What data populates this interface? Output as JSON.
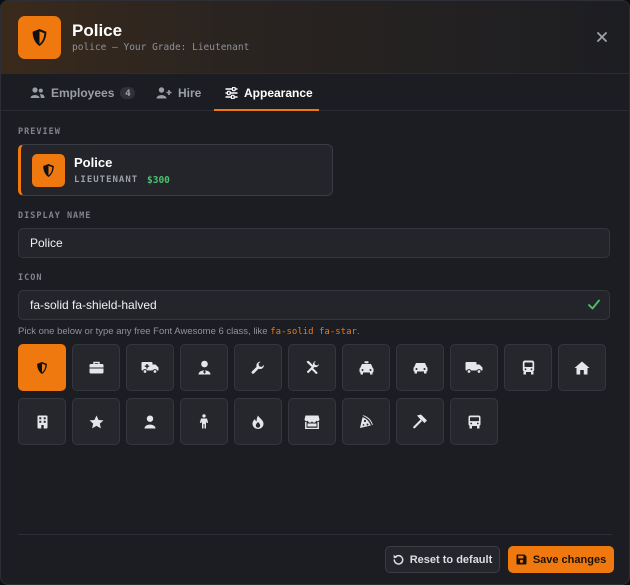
{
  "header": {
    "title": "Police",
    "subtitle": "police — Your Grade: Lieutenant",
    "icon": "shield-halved-icon"
  },
  "tabs": [
    {
      "label": "Employees",
      "count": "4",
      "icon": "users-icon"
    },
    {
      "label": "Hire",
      "icon": "user-plus-icon"
    },
    {
      "label": "Appearance",
      "icon": "sliders-icon",
      "active": true
    }
  ],
  "preview": {
    "section_label": "PREVIEW",
    "name": "Police",
    "grade": "LIEUTENANT",
    "salary": "$300"
  },
  "display_name": {
    "label": "DISPLAY NAME",
    "value": "Police"
  },
  "icon_field": {
    "label": "ICON",
    "value": "fa-solid fa-shield-halved"
  },
  "hint": {
    "text": "Pick one below or type any free Font Awesome 6 class, like ",
    "example": "fa-solid fa-star",
    "suffix": "."
  },
  "icon_grid": [
    "shield-halved-icon",
    "briefcase-icon",
    "truck-medical-icon",
    "user-doctor-icon",
    "wrench-icon",
    "screwdriver-wrench-icon",
    "taxi-icon",
    "car-icon",
    "truck-icon",
    "bus-icon",
    "house-icon",
    "building-icon",
    "star-icon",
    "user-icon",
    "person-icon",
    "fire-icon",
    "store-icon",
    "pizza-slice-icon",
    "hammer-icon",
    "van-shuttle-icon"
  ],
  "footer": {
    "reset_label": "Reset to default",
    "save_label": "Save changes"
  },
  "colors": {
    "accent": "#f0790f",
    "success": "#4cc26a"
  }
}
